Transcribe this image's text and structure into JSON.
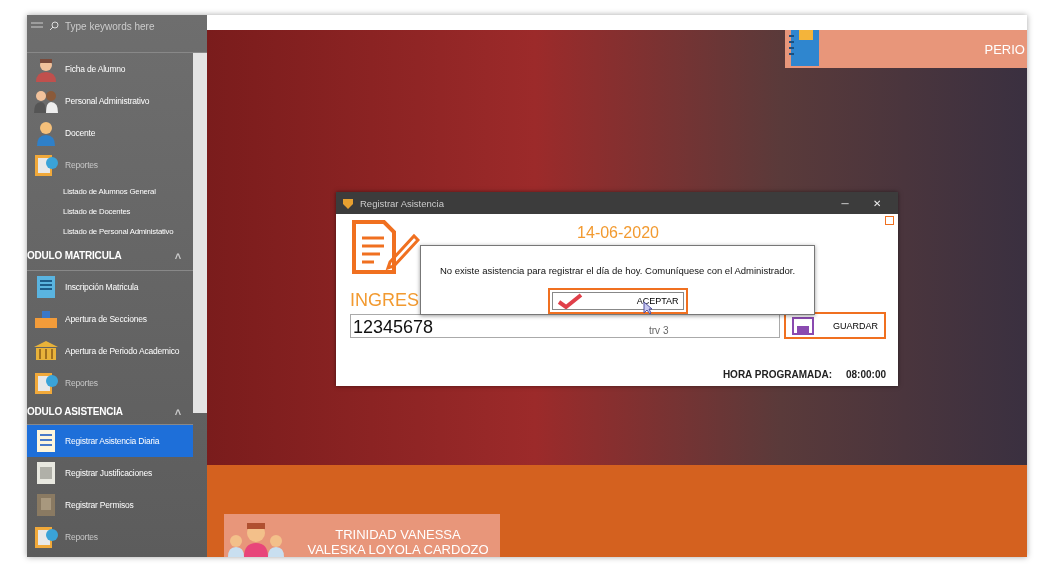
{
  "sidebar": {
    "search": {
      "placeholder": "Type keywords here"
    },
    "items": [
      {
        "kind": "item",
        "label": "Ficha de Alumno",
        "selected": false,
        "disabled": false
      },
      {
        "kind": "item",
        "label": "Personal Administrativo",
        "selected": false,
        "disabled": false
      },
      {
        "kind": "item",
        "label": "Docente",
        "selected": false,
        "disabled": false
      },
      {
        "kind": "item",
        "label": "Reportes",
        "selected": false,
        "disabled": true
      },
      {
        "kind": "subitem",
        "label": "Listado de Alumnos General",
        "selected": false,
        "disabled": false
      },
      {
        "kind": "subitem",
        "label": "Listado de Docentes",
        "selected": false,
        "disabled": false
      },
      {
        "kind": "subitem",
        "label": "Listado de Personal Administativo",
        "selected": false,
        "disabled": false
      },
      {
        "kind": "header",
        "label": "ODULO MATRICULA",
        "caret": "˄",
        "expanded": true
      },
      {
        "kind": "item",
        "label": "Inscripción Matricula",
        "selected": false,
        "disabled": false
      },
      {
        "kind": "item",
        "label": "Apertura de Secciones",
        "selected": false,
        "disabled": false
      },
      {
        "kind": "item",
        "label": "Apertura de Periodo Academico",
        "selected": false,
        "disabled": false
      },
      {
        "kind": "item",
        "label": "Reportes",
        "selected": false,
        "disabled": true
      },
      {
        "kind": "header",
        "label": "ODULO ASISTENCIA",
        "caret": "˄",
        "expanded": true
      },
      {
        "kind": "item",
        "label": "Registrar Asistencia Diaria",
        "selected": true,
        "disabled": false
      },
      {
        "kind": "item",
        "label": "Registrar Justificaciones",
        "selected": false,
        "disabled": false
      },
      {
        "kind": "item",
        "label": "Registrar Permisos",
        "selected": false,
        "disabled": false
      },
      {
        "kind": "item",
        "label": "Reportes",
        "selected": false,
        "disabled": true
      }
    ]
  },
  "period_tile": {
    "label": "PERIO"
  },
  "user_card": {
    "lines": [
      "TRINIDAD VANESSA",
      "VALESKA LOYOLA CARDOZO"
    ]
  },
  "dialog": {
    "title": "Registrar Asistencia",
    "minimize": "─",
    "close": "✕",
    "date": "14-06-2020",
    "field_label": "INGRES",
    "field_value": "12345678",
    "field_hint": "trv 3",
    "save_button": "GUARDAR",
    "schedule_label": "HORA PROGRAMADA:",
    "schedule_value": "08:00:00"
  },
  "message_box": {
    "text": "No existe asistencia para registrar el día de hoy. Comuníquese con el Administrador.",
    "button": "ACEPTAR"
  }
}
